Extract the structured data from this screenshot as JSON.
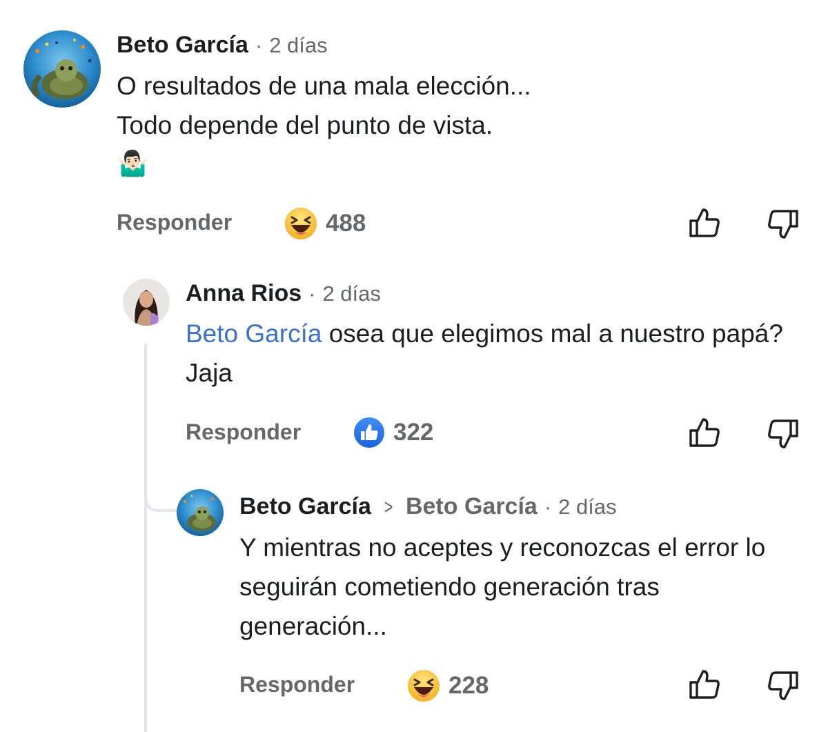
{
  "comments": [
    {
      "author": "Beto García",
      "separator": "·",
      "time": "2 días",
      "lines": [
        "O resultados de una mala elección...",
        "Todo depende del punto de vista."
      ],
      "emoji": "🤷🏻‍♂️",
      "reply_label": "Responder",
      "reaction": "haha",
      "reaction_count": "488"
    },
    {
      "author": "Anna Rios",
      "separator": "·",
      "time": "2 días",
      "mention": "Beto García",
      "text_after_mention": " osea que elegimos mal a nuestro papá? Jaja",
      "reply_label": "Responder",
      "reaction": "like",
      "reaction_count": "322"
    },
    {
      "author": "Beto García",
      "reply_to_arrow": ">",
      "reply_to": "Beto García",
      "separator": "·",
      "time": "2 días",
      "text": "Y mientras no aceptes y reconozcas el error lo seguirán cometiendo generación tras generación...",
      "reply_label": "Responder",
      "reaction": "haha",
      "reaction_count": "228"
    }
  ],
  "icons": {
    "upvote": "thumbs-up-outline-icon",
    "downvote": "thumbs-down-outline-icon"
  },
  "colors": {
    "mention": "#3a6fd4",
    "like_blue": "#2d7bf4",
    "secondary_text": "#65676b"
  }
}
